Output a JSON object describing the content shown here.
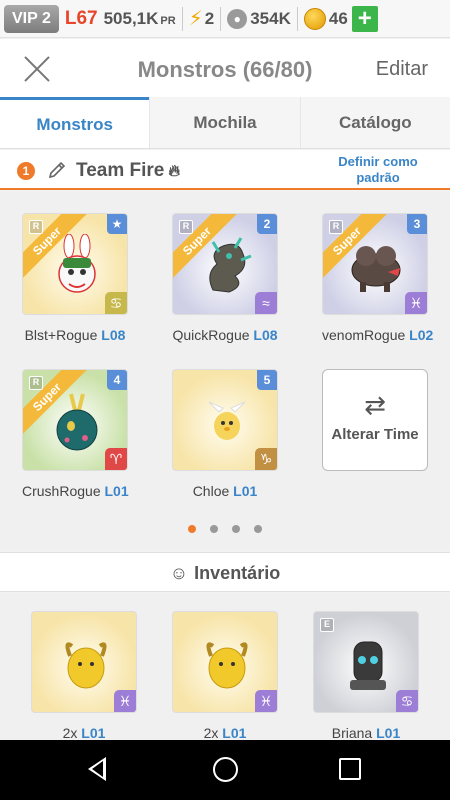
{
  "topbar": {
    "vip": "VIP 2",
    "level": "L67",
    "pr_value": "505,1K",
    "pr_unit": "PR",
    "energy": "2",
    "paws": "354K",
    "coins": "46",
    "plus": "+"
  },
  "header": {
    "title": "Monstros (66/80)",
    "edit": "Editar"
  },
  "tabs": [
    {
      "label": "Monstros",
      "active": true
    },
    {
      "label": "Mochila",
      "active": false
    },
    {
      "label": "Catálogo",
      "active": false
    }
  ],
  "team": {
    "number": "1",
    "name": "Team Fire",
    "set_default": "Definir como padrão"
  },
  "team_slots": [
    {
      "name": "Blst+Rogue",
      "level": "L08",
      "badge": "Super",
      "rank": "R",
      "corner": "★",
      "element": "♋",
      "color": "yellow"
    },
    {
      "name": "QuickRogue",
      "level": "L08",
      "badge": "Super",
      "rank": "R",
      "corner": "2",
      "element": "≈",
      "color": "purple"
    },
    {
      "name": "venomRogue",
      "level": "L02",
      "badge": "Super",
      "rank": "R",
      "corner": "3",
      "element": "♓",
      "color": "purple"
    },
    {
      "name": "CrushRogue",
      "level": "L01",
      "badge": "Super",
      "rank": "R",
      "corner": "4",
      "element": "♈",
      "color": "green"
    },
    {
      "name": "Chloe",
      "level": "L01",
      "badge": "",
      "rank": "",
      "corner": "5",
      "element": "♑",
      "color": "yellow"
    }
  ],
  "swap_button": {
    "label": "Alterar Time",
    "icon": "⇄"
  },
  "pager": {
    "count": 4,
    "active": 0
  },
  "inventory": {
    "title": "Inventário",
    "items": [
      {
        "name": "2x",
        "level": "L01",
        "element": "♓",
        "rank": ""
      },
      {
        "name": "2x",
        "level": "L01",
        "element": "♓",
        "rank": ""
      },
      {
        "name": "Briana",
        "level": "L01",
        "element": "♋",
        "rank": "E"
      }
    ]
  },
  "colors": {
    "accent_blue": "#3a85c8",
    "accent_orange": "#ef7a2a",
    "level_red": "#e8452b",
    "plus_green": "#3cb64a"
  }
}
